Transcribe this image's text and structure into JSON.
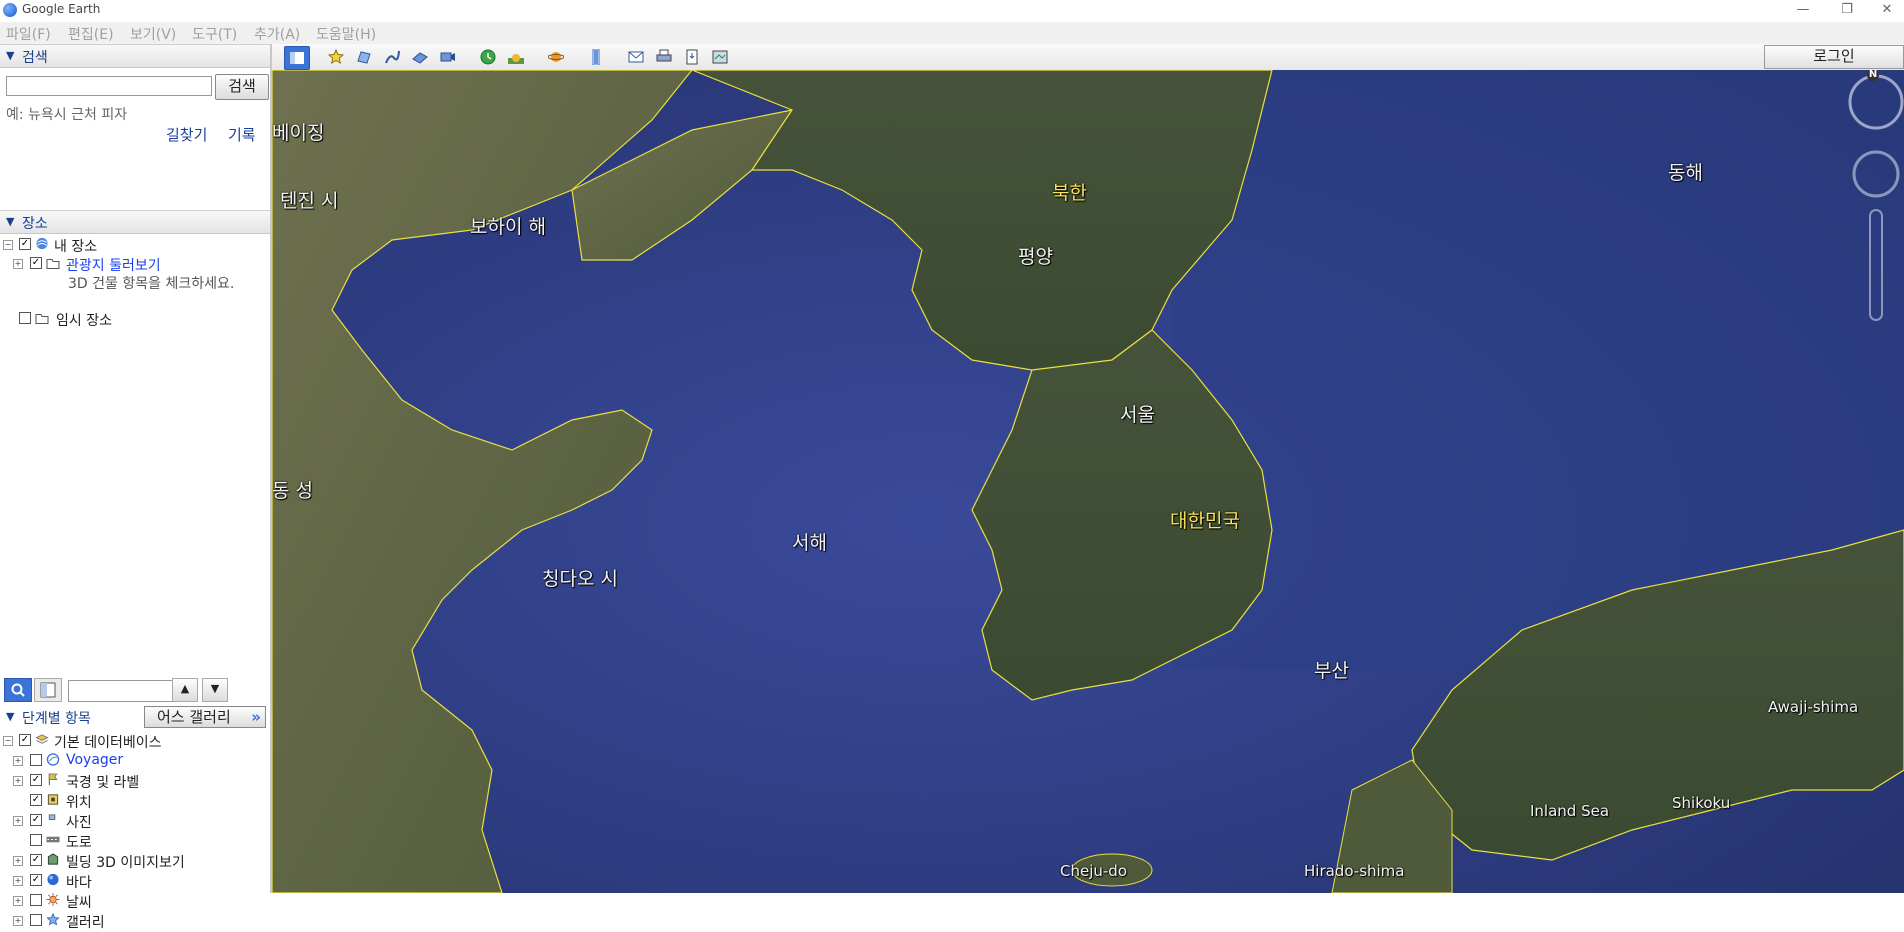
{
  "window": {
    "title": "Google Earth",
    "minimize": "—",
    "restore": "❐",
    "close": "✕"
  },
  "menu": [
    "파일(F)",
    "편집(E)",
    "보기(V)",
    "도구(T)",
    "추가(A)",
    "도움말(H)"
  ],
  "search": {
    "header": "검색",
    "input_value": "",
    "button": "검색",
    "hint": "예: 뉴욕시 근처 피자",
    "directions": "길찾기",
    "history": "기록"
  },
  "places": {
    "header": "장소",
    "items": [
      {
        "label": "내 장소",
        "checked": true,
        "icon": "globe-icon"
      },
      {
        "label": "관광지 둘러보기",
        "checked": true,
        "icon": "folder-icon"
      },
      {
        "label": "3D 건물 항목을 체크하세요.",
        "icon": ""
      },
      {
        "label": "임시 장소",
        "checked": false,
        "icon": "folder-icon"
      }
    ]
  },
  "layers": {
    "header": "단계별 항목",
    "gallery_button": "어스 갤러리",
    "gallery_chevron": "»",
    "items": [
      {
        "label": "기본 데이터베이스",
        "checked": true,
        "icon": "database-icon"
      },
      {
        "label": "Voyager",
        "checked": false,
        "icon": "voyager-icon"
      },
      {
        "label": "국경 및 라벨",
        "checked": true,
        "icon": "flag-icon"
      },
      {
        "label": "위치",
        "checked": true,
        "icon": "pin-icon"
      },
      {
        "label": "사진",
        "checked": true,
        "icon": "photo-icon"
      },
      {
        "label": "도로",
        "checked": false,
        "icon": "road-icon"
      },
      {
        "label": "빌딩 3D 이미지보기",
        "checked": true,
        "icon": "building-icon"
      },
      {
        "label": "바다",
        "checked": true,
        "icon": "ocean-icon"
      },
      {
        "label": "날씨",
        "checked": false,
        "icon": "sun-icon"
      },
      {
        "label": "갤러리",
        "checked": false,
        "icon": "star-icon"
      }
    ]
  },
  "toolbar": {
    "login": "로그인",
    "buttons": [
      "sidebar-toggle-icon",
      "add-placemark-icon",
      "add-polygon-icon",
      "add-path-icon",
      "add-overlay-icon",
      "record-tour-icon",
      "historical-imagery-icon",
      "sunlight-icon",
      "planets-icon",
      "ruler-icon",
      "email-icon",
      "print-icon",
      "save-image-icon",
      "view-in-maps-icon"
    ]
  },
  "map": {
    "labels": [
      {
        "text": "베이징",
        "color": "white"
      },
      {
        "text": "텐진 시",
        "color": "white"
      },
      {
        "text": "보하이 해",
        "color": "white"
      },
      {
        "text": "북한",
        "color": "yellow"
      },
      {
        "text": "평양",
        "color": "white"
      },
      {
        "text": "동해",
        "color": "white"
      },
      {
        "text": "서울",
        "color": "white"
      },
      {
        "text": "동 성",
        "color": "white"
      },
      {
        "text": "대한민국",
        "color": "yellow"
      },
      {
        "text": "서해",
        "color": "white"
      },
      {
        "text": "칭다오 시",
        "color": "white"
      },
      {
        "text": "부산",
        "color": "white"
      },
      {
        "text": "Awaji-shima",
        "color": "white"
      },
      {
        "text": "Inland Sea",
        "color": "white"
      },
      {
        "text": "Shikoku",
        "color": "white"
      },
      {
        "text": "Cheju-do",
        "color": "white"
      },
      {
        "text": "Hirado-shima",
        "color": "white"
      }
    ],
    "compass_north": "N"
  }
}
